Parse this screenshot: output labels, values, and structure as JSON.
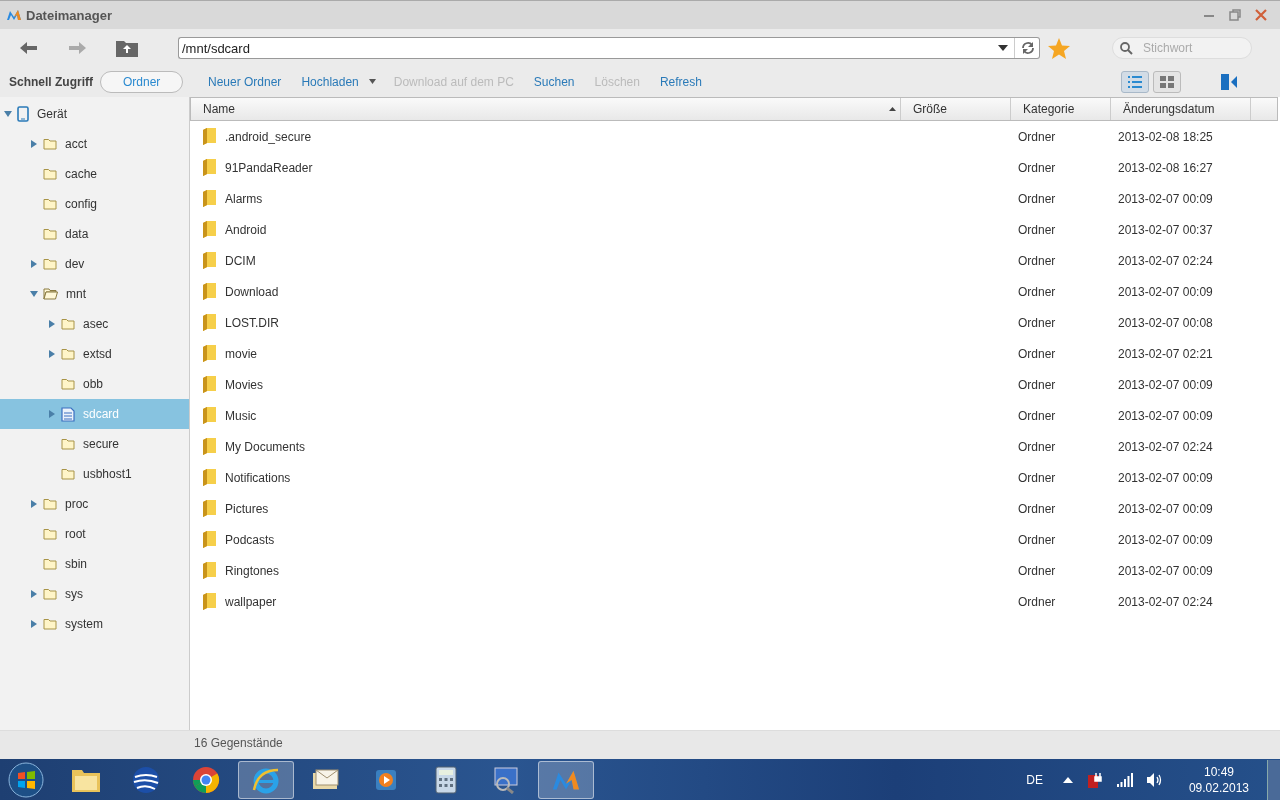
{
  "window": {
    "title": "Dateimanager"
  },
  "address": {
    "value": "/mnt/sdcard"
  },
  "search": {
    "placeholder": "Stichwort"
  },
  "sidebar_tabs": [
    {
      "label": "Schnell Zugriff",
      "selected": false
    },
    {
      "label": "Ordner",
      "selected": true
    }
  ],
  "actions": [
    {
      "label": "Neuer Ordner",
      "disabled": false,
      "dropdown": false
    },
    {
      "label": "Hochladen",
      "disabled": false,
      "dropdown": true
    },
    {
      "label": "Download auf dem PC",
      "disabled": true,
      "dropdown": false
    },
    {
      "label": "Suchen",
      "disabled": false,
      "dropdown": false
    },
    {
      "label": "Löschen",
      "disabled": true,
      "dropdown": false
    },
    {
      "label": "Refresh",
      "disabled": false,
      "dropdown": false
    }
  ],
  "view_modes": [
    {
      "kind": "list",
      "selected": true
    },
    {
      "kind": "grid",
      "selected": false
    }
  ],
  "tree": [
    {
      "label": "Gerät",
      "kind": "device",
      "expanded": true,
      "selected": false,
      "children": [
        {
          "label": "acct",
          "kind": "folder",
          "expanded": false,
          "selected": false
        },
        {
          "label": "cache",
          "kind": "folder",
          "selected": false
        },
        {
          "label": "config",
          "kind": "folder",
          "selected": false
        },
        {
          "label": "data",
          "kind": "folder",
          "selected": false
        },
        {
          "label": "dev",
          "kind": "folder",
          "expanded": false,
          "selected": false
        },
        {
          "label": "mnt",
          "kind": "folder",
          "expanded": true,
          "selected": false,
          "children": [
            {
              "label": "asec",
              "kind": "folder",
              "expanded": false,
              "selected": false
            },
            {
              "label": "extsd",
              "kind": "folder",
              "expanded": false,
              "selected": false
            },
            {
              "label": "obb",
              "kind": "folder",
              "selected": false
            },
            {
              "label": "sdcard",
              "kind": "sdcard",
              "expanded": false,
              "selected": true
            },
            {
              "label": "secure",
              "kind": "folder",
              "selected": false
            },
            {
              "label": "usbhost1",
              "kind": "folder",
              "selected": false
            }
          ]
        },
        {
          "label": "proc",
          "kind": "folder",
          "expanded": false,
          "selected": false
        },
        {
          "label": "root",
          "kind": "folder",
          "selected": false
        },
        {
          "label": "sbin",
          "kind": "folder",
          "selected": false
        },
        {
          "label": "sys",
          "kind": "folder",
          "expanded": false,
          "selected": false
        },
        {
          "label": "system",
          "kind": "folder",
          "expanded": false,
          "selected": false
        }
      ]
    }
  ],
  "table": {
    "columns": [
      {
        "label": "Name",
        "sorted": true
      },
      {
        "label": "Größe",
        "sorted": false
      },
      {
        "label": "Kategorie",
        "sorted": false
      },
      {
        "label": "Änderungsdatum",
        "sorted": false
      }
    ],
    "rows": [
      {
        "name": ".android_secure",
        "category": "Ordner",
        "date": "2013-02-08 18:25"
      },
      {
        "name": "91PandaReader",
        "category": "Ordner",
        "date": "2013-02-08 16:27"
      },
      {
        "name": "Alarms",
        "category": "Ordner",
        "date": "2013-02-07 00:09"
      },
      {
        "name": "Android",
        "category": "Ordner",
        "date": "2013-02-07 00:37"
      },
      {
        "name": "DCIM",
        "category": "Ordner",
        "date": "2013-02-07 02:24"
      },
      {
        "name": "Download",
        "category": "Ordner",
        "date": "2013-02-07 00:09"
      },
      {
        "name": "LOST.DIR",
        "category": "Ordner",
        "date": "2013-02-07 00:08"
      },
      {
        "name": "movie",
        "category": "Ordner",
        "date": "2013-02-07 02:21"
      },
      {
        "name": "Movies",
        "category": "Ordner",
        "date": "2013-02-07 00:09"
      },
      {
        "name": "Music",
        "category": "Ordner",
        "date": "2013-02-07 00:09"
      },
      {
        "name": "My Documents",
        "category": "Ordner",
        "date": "2013-02-07 02:24"
      },
      {
        "name": "Notifications",
        "category": "Ordner",
        "date": "2013-02-07 00:09"
      },
      {
        "name": "Pictures",
        "category": "Ordner",
        "date": "2013-02-07 00:09"
      },
      {
        "name": "Podcasts",
        "category": "Ordner",
        "date": "2013-02-07 00:09"
      },
      {
        "name": "Ringtones",
        "category": "Ordner",
        "date": "2013-02-07 00:09"
      },
      {
        "name": "wallpaper",
        "category": "Ordner",
        "date": "2013-02-07 02:24"
      }
    ]
  },
  "status_bar": {
    "text": "16 Gegenstände"
  },
  "taskbar": {
    "items": [
      {
        "kind": "files",
        "active": false
      },
      {
        "kind": "globe",
        "active": false
      },
      {
        "kind": "chrome",
        "active": false
      },
      {
        "kind": "ie",
        "active": true
      },
      {
        "kind": "mail",
        "active": false
      },
      {
        "kind": "media",
        "active": false
      },
      {
        "kind": "calculator",
        "active": false
      },
      {
        "kind": "monitor",
        "active": false
      },
      {
        "kind": "app",
        "active": true
      }
    ],
    "language": "DE",
    "time": "10:49",
    "date": "09.02.2013"
  }
}
